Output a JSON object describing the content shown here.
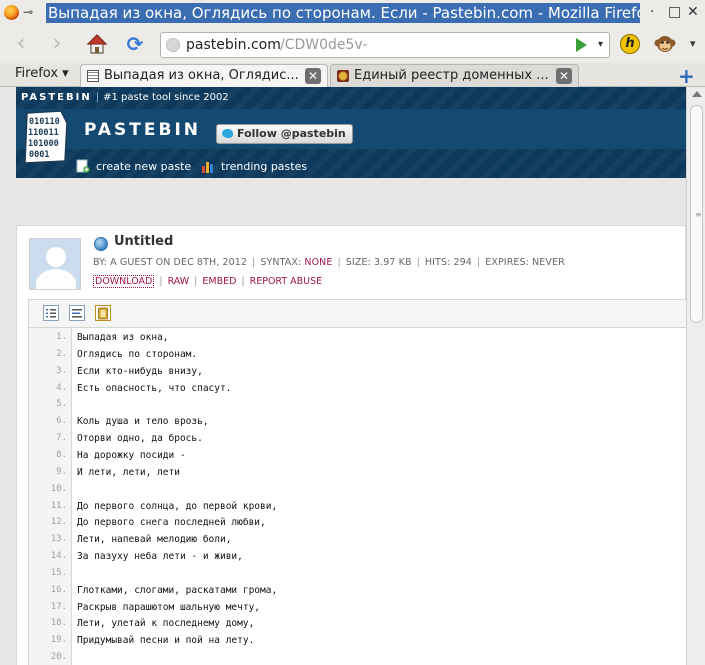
{
  "window": {
    "title": "Выпадая из окна, Оглядись по сторонам. Если - Pastebin.com - Mozilla Firefo",
    "minimize_glyph": "·",
    "maximize_glyph": "□",
    "close_glyph": "✕",
    "pin_glyph": "⊸"
  },
  "navbar": {
    "url_host": "pastebin.com",
    "url_path": "/CDW0de5v-",
    "back_glyph": "‹",
    "forward_glyph": "›",
    "reload_glyph": "⟳",
    "addon_glyph": "h",
    "dropdown_glyph": "▾"
  },
  "tabbar": {
    "menu_label": "Firefox ▾",
    "tabs": [
      {
        "label": "Выпадая из окна, Оглядис...",
        "active": true
      },
      {
        "label": "Единый реестр доменных ...",
        "active": false
      }
    ],
    "close_glyph": "✕",
    "new_tab_glyph": "+"
  },
  "pastebin": {
    "brand": "PASTEBIN",
    "tagline": "#1 paste tool since 2002",
    "wordmark": "PASTEBIN",
    "logo_digits": [
      "010110",
      "110011",
      "101000",
      "0001"
    ],
    "follow_label": "Follow @pastebin",
    "nav": [
      "create new paste",
      "trending pastes"
    ]
  },
  "paste": {
    "title": "Untitled",
    "by": "BY: A GUEST ON DEC 8TH, 2012",
    "syntax_label": "SYNTAX:",
    "syntax_value": "NONE",
    "size": "SIZE: 3.97 KB",
    "hits": "HITS: 294",
    "expires": "EXPIRES: NEVER",
    "actions": [
      "DOWNLOAD",
      "RAW",
      "EMBED",
      "REPORT ABUSE"
    ],
    "separator": "|"
  },
  "code": {
    "lines": [
      {
        "n": "1.",
        "text": "Выпадая из окна,"
      },
      {
        "n": "2.",
        "text": "Оглядись по сторонам."
      },
      {
        "n": "3.",
        "text": "Если кто-нибудь внизу,"
      },
      {
        "n": "4.",
        "text": "Есть опасность, что спасут."
      },
      {
        "n": "5.",
        "text": ""
      },
      {
        "n": "6.",
        "text": "Коль душа и тело врозь,"
      },
      {
        "n": "7.",
        "text": "Оторви одно, да брось."
      },
      {
        "n": "8.",
        "text": "На дорожку посиди -"
      },
      {
        "n": "9.",
        "text": "И лети, лети, лети"
      },
      {
        "n": "10.",
        "text": ""
      },
      {
        "n": "11.",
        "text": "До первого солнца, до первой крови,"
      },
      {
        "n": "12.",
        "text": "До первого снега последней любви,"
      },
      {
        "n": "13.",
        "text": "Лети, напевай мелодию боли,"
      },
      {
        "n": "14.",
        "text": "За пазуху неба лети - и живи,"
      },
      {
        "n": "15.",
        "text": ""
      },
      {
        "n": "16.",
        "text": "Глотками, слогами, раскатами грома,"
      },
      {
        "n": "17.",
        "text": "Раскрыв парашютом шальную мечту,"
      },
      {
        "n": "18.",
        "text": "Лети, улетай к последнему дому,"
      },
      {
        "n": "19.",
        "text": "Придумывай песни и пой на лету."
      },
      {
        "n": "20.",
        "text": ""
      }
    ]
  },
  "colors": {
    "header_bg": "#0d3a5c",
    "accent_link": "#a0154f",
    "title_highlight": "#3b6db3"
  }
}
